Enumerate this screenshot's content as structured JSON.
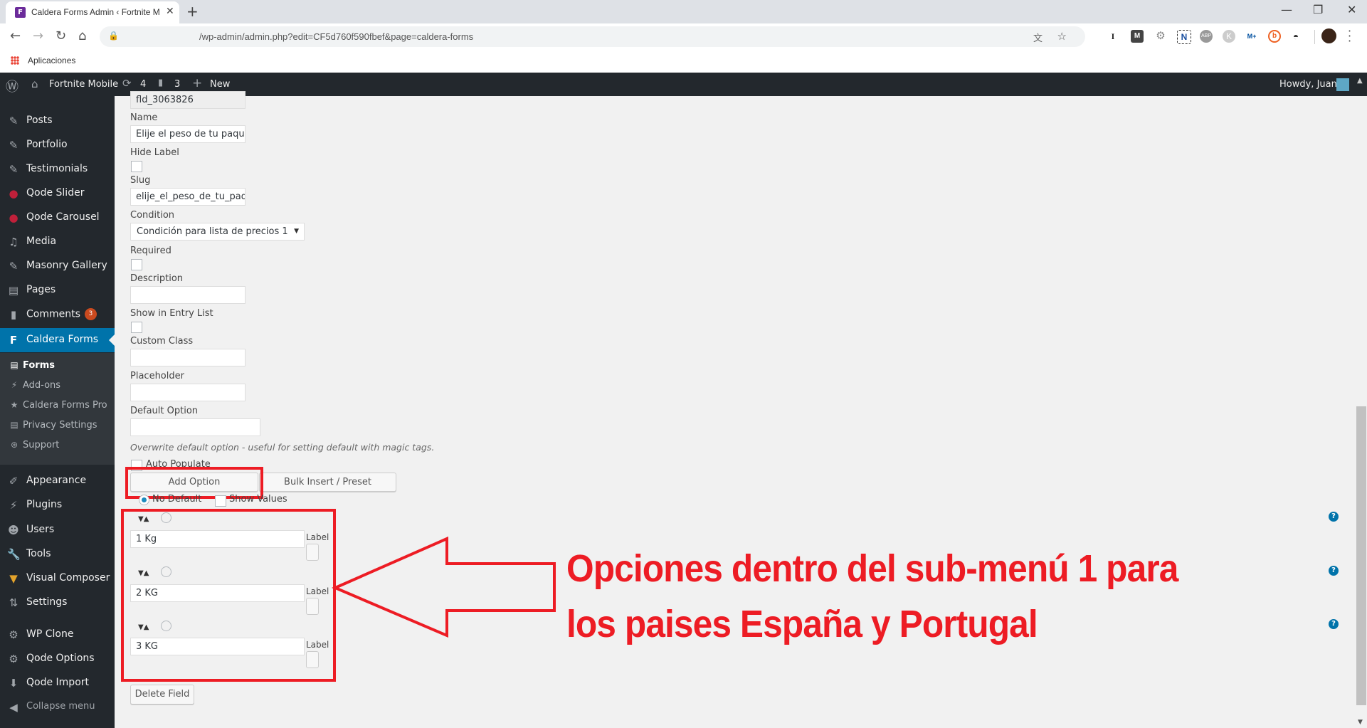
{
  "browser": {
    "tab_title": "Caldera Forms Admin ‹ Fortnite M",
    "tab_favicon": "caldera-forms-icon",
    "new_tab": "+",
    "url": "/wp-admin/admin.php?edit=CF5d760f590fbef&page=caldera-forms",
    "bookmarks": [
      {
        "label": "Aplicaciones",
        "icon": "apps-grid-icon"
      }
    ],
    "extensions": [
      "translate-icon",
      "star-icon",
      "instapaper-icon",
      "mega-icon",
      "settings-gear-icon",
      "notion-clipper-icon",
      "adblock-plus-icon",
      "k-extension-icon",
      "movistar-plus-icon",
      "bitly-icon",
      "incognito-icon",
      "profile-avatar",
      "kebab-menu-icon"
    ],
    "window_controls": {
      "minimize": "—",
      "restore": "❐",
      "close": "✕"
    }
  },
  "adminbar": {
    "site_name": "Fortnite Mobile",
    "updates_count": "4",
    "comments_count": "3",
    "new_label": "New",
    "greeting": "Howdy, Juan"
  },
  "sidebar": {
    "items": [
      {
        "label": "Posts",
        "icon": "pin-icon"
      },
      {
        "label": "Portfolio",
        "icon": "pin-icon"
      },
      {
        "label": "Testimonials",
        "icon": "pin-icon"
      },
      {
        "label": "Qode Slider",
        "icon": "qode-icon"
      },
      {
        "label": "Qode Carousel",
        "icon": "qode-icon"
      },
      {
        "label": "Media",
        "icon": "media-icon"
      },
      {
        "label": "Masonry Gallery",
        "icon": "pin-icon"
      },
      {
        "label": "Pages",
        "icon": "pages-icon"
      },
      {
        "label": "Comments",
        "icon": "comment-icon",
        "badge": "3"
      },
      {
        "label": "Caldera Forms",
        "icon": "caldera-icon",
        "active": true
      }
    ],
    "submenu": [
      {
        "label": "Forms",
        "icon": "forms-icon",
        "current": true
      },
      {
        "label": "Add-ons",
        "icon": "plug-icon"
      },
      {
        "label": "Caldera Forms Pro",
        "icon": "star-icon"
      },
      {
        "label": "Privacy Settings",
        "icon": "pages-icon"
      },
      {
        "label": "Support",
        "icon": "support-icon"
      }
    ],
    "items2": [
      {
        "label": "Appearance",
        "icon": "brush-icon"
      },
      {
        "label": "Plugins",
        "icon": "plug-icon"
      },
      {
        "label": "Users",
        "icon": "user-icon"
      },
      {
        "label": "Tools",
        "icon": "wrench-icon"
      },
      {
        "label": "Visual Composer",
        "icon": "vc-icon"
      },
      {
        "label": "Settings",
        "icon": "settings-icon"
      },
      {
        "label": "WP Clone",
        "icon": "gear-icon"
      },
      {
        "label": "Qode Options",
        "icon": "gear-icon"
      },
      {
        "label": "Qode Import",
        "icon": "import-icon"
      },
      {
        "label": "Collapse menu",
        "icon": "collapse-icon"
      }
    ]
  },
  "field": {
    "id_value": "fld_3063826",
    "name_label": "Name",
    "name_value": "Elije el peso de tu paque",
    "hide_label": "Hide Label",
    "slug_label": "Slug",
    "slug_value": "elije_el_peso_de_tu_paqu",
    "condition_label": "Condition",
    "condition_value": "Condición para lista de precios 1",
    "required_label": "Required",
    "description_label": "Description",
    "description_value": "",
    "show_in_entry_label": "Show in Entry List",
    "custom_class_label": "Custom Class",
    "custom_class_value": "",
    "placeholder_label": "Placeholder",
    "placeholder_value": "",
    "default_option_label": "Default Option",
    "default_option_value": "",
    "default_option_help": "Overwrite default option - useful for setting default with magic tags.",
    "auto_populate_label": "Auto Populate",
    "add_option_label": "Add Option",
    "bulk_insert_label": "Bulk Insert / Preset",
    "no_default_label": "No Default",
    "show_values_label": "Show Values",
    "options": [
      {
        "value": "1 Kg",
        "label_caption": "Label"
      },
      {
        "value": "2 KG",
        "label_caption": "Label"
      },
      {
        "value": "3 KG",
        "label_caption": "Label"
      }
    ],
    "delete_field_label": "Delete Field"
  },
  "annotation": {
    "line1": "Opciones dentro del sub-menú 1 para",
    "line2": "los paises España y Portugal",
    "color": "#ed1c24"
  },
  "help_icon_glyph": "?"
}
